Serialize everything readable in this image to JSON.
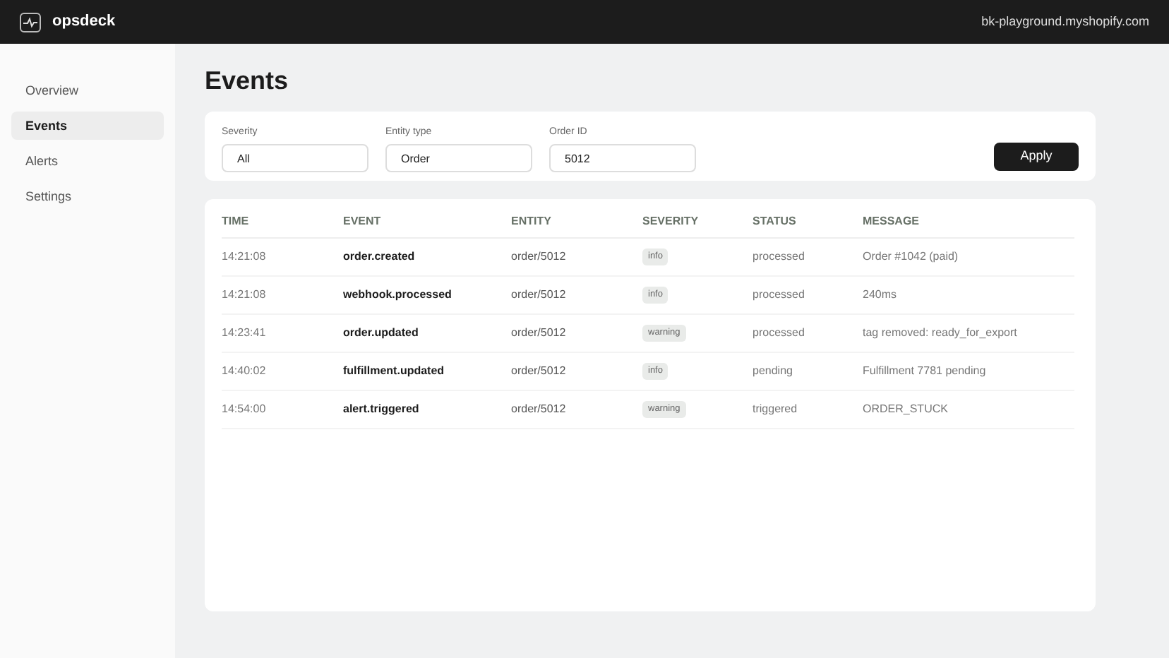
{
  "app": {
    "name": "opsdeck",
    "store": "bk-playground.myshopify.com"
  },
  "sidebar": {
    "items": [
      {
        "label": "Overview",
        "selected": false
      },
      {
        "label": "Events",
        "selected": true
      },
      {
        "label": "Alerts",
        "selected": false
      },
      {
        "label": "Settings",
        "selected": false
      }
    ]
  },
  "page": {
    "title": "Events"
  },
  "filters": {
    "fields": [
      {
        "label": "Severity",
        "value": "All"
      },
      {
        "label": "Entity type",
        "value": "Order"
      },
      {
        "label": "Order ID",
        "value": "5012"
      }
    ],
    "apply_button": "Apply"
  },
  "table": {
    "columns": [
      "TIME",
      "EVENT",
      "ENTITY",
      "SEVERITY",
      "STATUS",
      "MESSAGE"
    ],
    "rows": [
      [
        "14:21:08",
        "order.created",
        "order/5012",
        "info",
        "processed",
        "Order #1042 (paid)"
      ],
      [
        "14:21:08",
        "webhook.processed",
        "order/5012",
        "info",
        "processed",
        "240ms"
      ],
      [
        "14:23:41",
        "order.updated",
        "order/5012",
        "warning",
        "processed",
        "tag removed: ready_for_export"
      ],
      [
        "14:40:02",
        "fulfillment.updated",
        "order/5012",
        "info",
        "pending",
        "Fulfillment 7781 pending"
      ],
      [
        "14:54:00",
        "alert.triggered",
        "order/5012",
        "warning",
        "triggered",
        "ORDER_STUCK"
      ]
    ]
  }
}
